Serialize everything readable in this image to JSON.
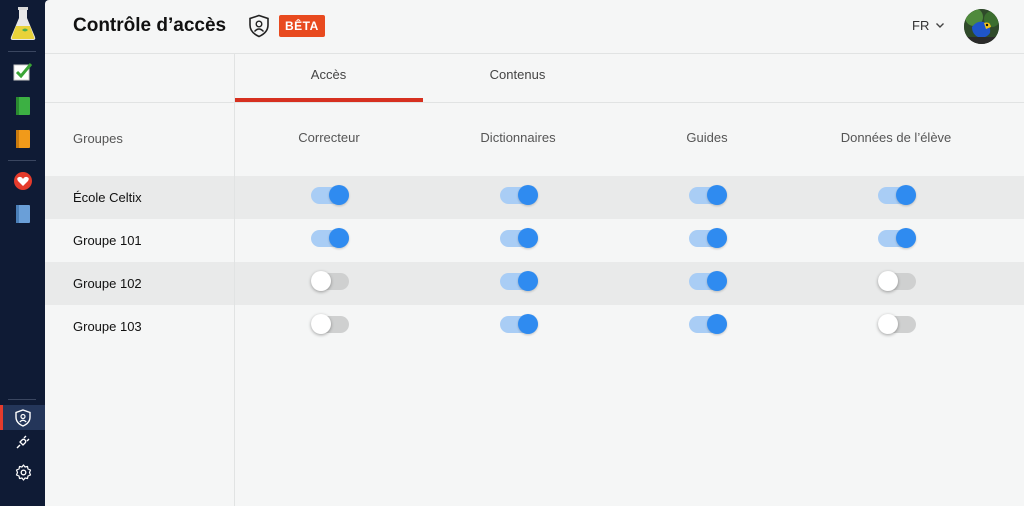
{
  "header": {
    "title": "Contrôle d’accès",
    "badge": "BÊTA",
    "language": "FR"
  },
  "tabs": [
    {
      "label": "Accès",
      "active": true
    },
    {
      "label": "Contenus",
      "active": false
    }
  ],
  "table": {
    "groups_header": "Groupes",
    "columns": [
      "Correcteur",
      "Dictionnaires",
      "Guides",
      "Données de l’élève"
    ],
    "rows": [
      {
        "group": "École Celtix",
        "toggles": [
          true,
          true,
          true,
          true
        ]
      },
      {
        "group": "Groupe 101",
        "toggles": [
          true,
          true,
          true,
          true
        ]
      },
      {
        "group": "Groupe 102",
        "toggles": [
          false,
          true,
          true,
          false
        ]
      },
      {
        "group": "Groupe 103",
        "toggles": [
          false,
          true,
          true,
          false
        ]
      }
    ]
  },
  "sidebar": {
    "items": [
      {
        "icon": "flask-logo-icon"
      },
      {
        "icon": "checkmark-icon"
      },
      {
        "icon": "green-book-icon"
      },
      {
        "icon": "orange-book-icon"
      },
      {
        "icon": "heart-icon"
      },
      {
        "icon": "blue-book-icon"
      },
      {
        "icon": "shield-icon",
        "active": true
      },
      {
        "icon": "plug-icon"
      },
      {
        "icon": "settings-gear-icon"
      }
    ]
  },
  "colors": {
    "sidebar_bg": "#0f1b35",
    "accent_red": "#d6301f",
    "badge_orange": "#e84a1f",
    "toggle_on": "#2f8bf0",
    "toggle_on_track": "#a9cdf5"
  }
}
